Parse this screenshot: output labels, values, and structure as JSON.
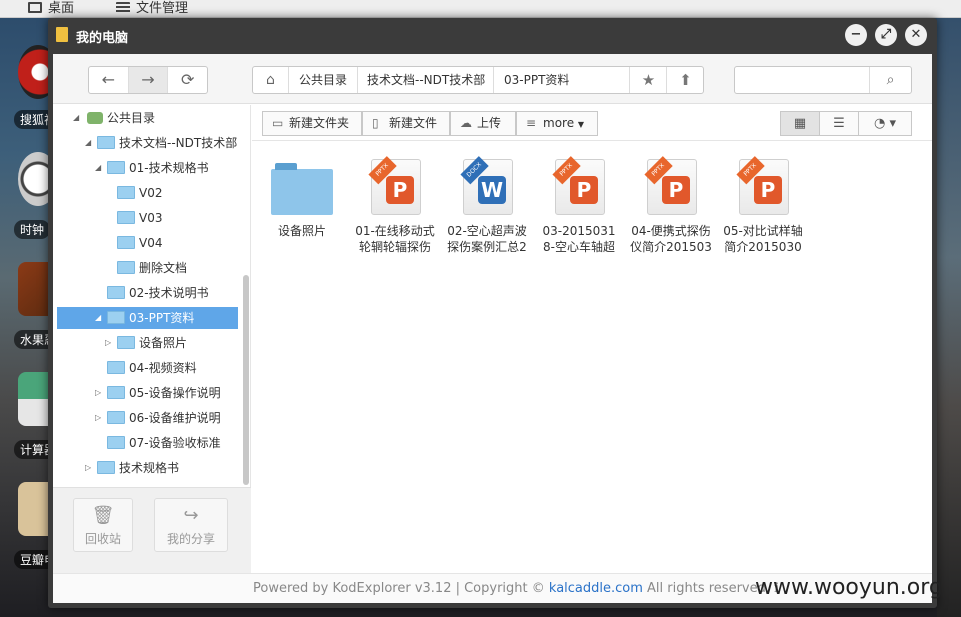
{
  "taskbar": {
    "tabs": [
      {
        "label": "桌面",
        "icon": "monitor-icon"
      },
      {
        "label": "文件管理",
        "icon": "list-icon"
      }
    ]
  },
  "desktop": {
    "icons": [
      {
        "label": "搜狐视",
        "icon": "sohu-icon",
        "color": "#c0201a"
      },
      {
        "label": "时钟",
        "icon": "clock-icon",
        "color": "#dddddd"
      },
      {
        "label": "水果忍",
        "icon": "fruit-icon",
        "color": "#7a3a1c"
      },
      {
        "label": "计算器",
        "icon": "calculator-icon",
        "color": "#4aa57a"
      },
      {
        "label": "豆瓣电",
        "icon": "radio-icon",
        "color": "#d9c39a"
      }
    ]
  },
  "window": {
    "title": "我的电脑",
    "controls": {
      "minimize": "−",
      "maximize": "⤢",
      "close": "✕"
    }
  },
  "nav": {
    "back": "←",
    "forward": "→",
    "refresh": "⟳"
  },
  "address": {
    "home_icon": "⌂",
    "crumbs": [
      "公共目录",
      "技术文档--NDT技术部",
      "03-PPT资料"
    ],
    "star": "★",
    "up": "⬆"
  },
  "search": {
    "value": "",
    "placeholder": "",
    "icon": "⌕"
  },
  "tree": [
    {
      "label": "公共目录",
      "level": 0,
      "arrow": "◢",
      "icon": "cloud-folder"
    },
    {
      "label": "技术文档--NDT技术部",
      "level": 1,
      "arrow": "◢"
    },
    {
      "label": "01-技术规格书",
      "level": 2,
      "arrow": "◢"
    },
    {
      "label": "V02",
      "level": 3,
      "arrow": ""
    },
    {
      "label": "V03",
      "level": 3,
      "arrow": ""
    },
    {
      "label": "V04",
      "level": 3,
      "arrow": ""
    },
    {
      "label": "删除文档",
      "level": 3,
      "arrow": ""
    },
    {
      "label": "02-技术说明书",
      "level": 2,
      "arrow": ""
    },
    {
      "label": "03-PPT资料",
      "level": 2,
      "arrow": "◢",
      "selected": true
    },
    {
      "label": "设备照片",
      "level": 3,
      "arrow": "▷"
    },
    {
      "label": "04-视频资料",
      "level": 2,
      "arrow": ""
    },
    {
      "label": "05-设备操作说明",
      "level": 2,
      "arrow": "▷"
    },
    {
      "label": "06-设备维护说明",
      "level": 2,
      "arrow": "▷"
    },
    {
      "label": "07-设备验收标准",
      "level": 2,
      "arrow": ""
    },
    {
      "label": "技术规格书",
      "level": 1,
      "arrow": "▷"
    }
  ],
  "sidebar_footer": {
    "recycle": "回收站",
    "share": "我的分享"
  },
  "actions": {
    "new_folder": "新建文件夹",
    "new_file": "新建文件",
    "upload": "上传",
    "more": "more"
  },
  "files": [
    {
      "name": "设备照片",
      "type": "folder"
    },
    {
      "name": "01-在线移动式\n轮辋轮辐探伤",
      "type": "pptx"
    },
    {
      "name": "02-空心超声波\n探伤案例汇总2",
      "type": "docx"
    },
    {
      "name": "03-2015031\n8-空心车轴超",
      "type": "pptx"
    },
    {
      "name": "04-便携式探伤\n仪简介201503",
      "type": "pptx"
    },
    {
      "name": "05-对比试样轴\n简介2015030",
      "type": "pptx"
    }
  ],
  "footer": {
    "prefix": "Powered by KodExplorer v3.12 | Copyright © ",
    "link": "kalcaddle.com",
    "suffix": " All rights reserved.",
    "info": "ℹ"
  },
  "watermark": "www.wooyun.org"
}
